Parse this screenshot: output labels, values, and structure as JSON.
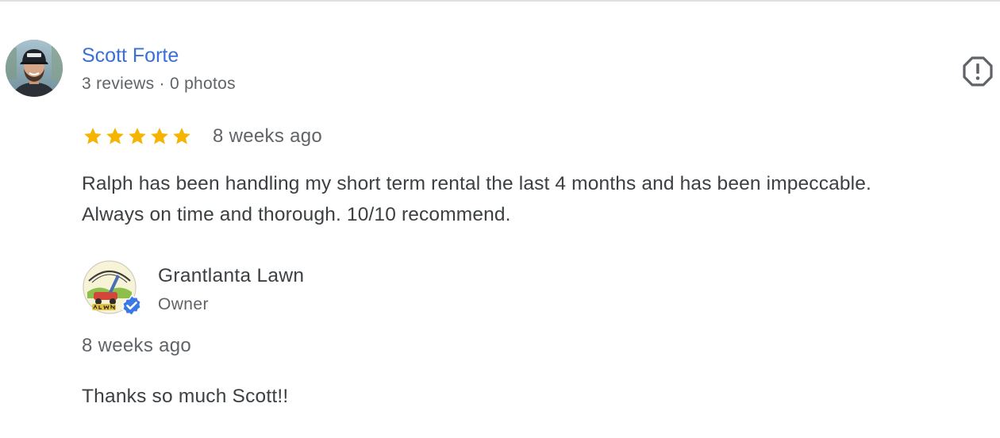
{
  "review": {
    "reviewer_name": "Scott Forte",
    "reviewer_meta": "3 reviews · 0 photos",
    "rating": 5,
    "rating_max": 5,
    "date": "8 weeks ago",
    "text_lines": [
      "Ralph has been handling my short term rental the last 4 months and has been impeccable.",
      "Always on time and thorough. 10/10 recommend."
    ],
    "report_icon": "report-flag-icon",
    "star_color": "#f4b400"
  },
  "owner_reply": {
    "name": "Grantlanta Lawn",
    "role": "Owner",
    "verified_icon": "verified-badge-icon",
    "verified_color": "#3b78e7",
    "date": "8 weeks ago",
    "text": "Thanks so much Scott!!"
  },
  "colors": {
    "reviewer_link": "#3a6fd8",
    "body_text": "#3c4043",
    "secondary_text": "#606468"
  }
}
